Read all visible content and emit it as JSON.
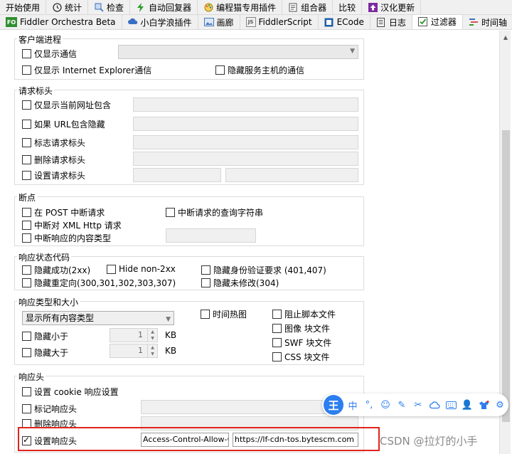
{
  "tabs_row1": [
    {
      "label": "开始使用",
      "icon": "none",
      "color": ""
    },
    {
      "label": "统计",
      "icon": "clock-icon",
      "color": "#333333"
    },
    {
      "label": "检查",
      "icon": "magnifier-icon",
      "color": "#3b6fb6"
    },
    {
      "label": "自动回复器",
      "icon": "lightning-icon",
      "color": "#2a9d2a"
    },
    {
      "label": "编程猫专用插件",
      "icon": "palette-icon",
      "color": "#d9534f"
    },
    {
      "label": "组合器",
      "icon": "form-icon",
      "color": "#555555"
    },
    {
      "label": "比较",
      "icon": "none",
      "color": ""
    },
    {
      "label": "汉化更新",
      "icon": "upload-icon",
      "color": "#7b2aa0"
    }
  ],
  "tabs_row2": [
    {
      "label": "Fiddler Orchestra Beta",
      "icon": "fo-icon",
      "icon_text": "FO",
      "color": "#2f8f2f"
    },
    {
      "label": "小白学浪插件",
      "icon": "cloud-icon",
      "icon_text": "",
      "color": "#3a6fc4"
    },
    {
      "label": "画廊",
      "icon": "image-icon",
      "icon_text": "",
      "color": "#4a78b8"
    },
    {
      "label": "FiddlerScript",
      "icon": "js-icon",
      "icon_text": "JS",
      "color": "#666666"
    },
    {
      "label": "ECode",
      "icon": "ecode-icon",
      "icon_text": "",
      "color": "#1e5fa8"
    },
    {
      "label": "日志",
      "icon": "log-icon",
      "icon_text": "",
      "color": "#444444"
    },
    {
      "label": "过滤器",
      "icon": "checkbox-icon",
      "icon_text": "",
      "color": "#2a9d2a",
      "active": true
    },
    {
      "label": "时间轴",
      "icon": "timeline-icon",
      "icon_text": "",
      "color": "#3a6fc4"
    }
  ],
  "client_process": {
    "title": "客户端进程",
    "show_only_traffic": "仅显示通信",
    "show_only_ie": "仅显示 Internet Explorer通信",
    "hide_service_host": "隐藏服务主机的通信"
  },
  "request_headers": {
    "title": "请求标头",
    "show_only_url_contains": "仅显示当前网址包含",
    "hide_if_url_contains": "如果 URL包含隐藏",
    "flag_request_header": "标志请求标头",
    "delete_request_header": "删除请求标头",
    "set_request_header": "设置请求标头"
  },
  "breakpoints": {
    "title": "断点",
    "break_on_post": "在 POST 中断请求",
    "break_on_query": "中断请求的查询字符串",
    "break_on_xhr": "中断对 XML Http 请求",
    "break_on_content_type": "中断响应的内容类型"
  },
  "status_codes": {
    "title": "响应状态代码",
    "hide_success": "隐藏成功(2xx)",
    "hide_non_2xx": "Hide non-2xx",
    "hide_auth": "隐藏身份验证要求 (401,407)",
    "hide_redirects": "隐藏重定向(300,301,302,303,307)",
    "hide_not_modified": "隐藏未修改(304)"
  },
  "type_size": {
    "title": "响应类型和大小",
    "content_type_selected": "显示所有内容类型",
    "time_heatmap": "时间热图",
    "block_script": "阻止脚本文件",
    "block_image": "图像 块文件",
    "block_swf": "SWF 块文件",
    "block_css": "CSS 块文件",
    "hide_smaller": "隐藏小于",
    "hide_larger": "隐藏大于",
    "smaller_value": "1",
    "larger_value": "1",
    "unit": "KB"
  },
  "response_headers": {
    "title": "响应头",
    "set_cookie": "设置 cookie 响应设置",
    "flag_header": "标记响应头",
    "delete_header": "删除响应头",
    "set_header": "设置响应头",
    "header_name": "Access-Control-Allow-Ori",
    "header_value": "https://lf-cdn-tos.bytescm.com"
  },
  "ime_toolbar": {
    "logo": "王",
    "mode": "中",
    "accent": "#2c7df0"
  },
  "watermark": "CSDN @拉灯的小手",
  "colors": {
    "highlight_border": "#e0241c",
    "group_border": "#dcdcdc"
  }
}
